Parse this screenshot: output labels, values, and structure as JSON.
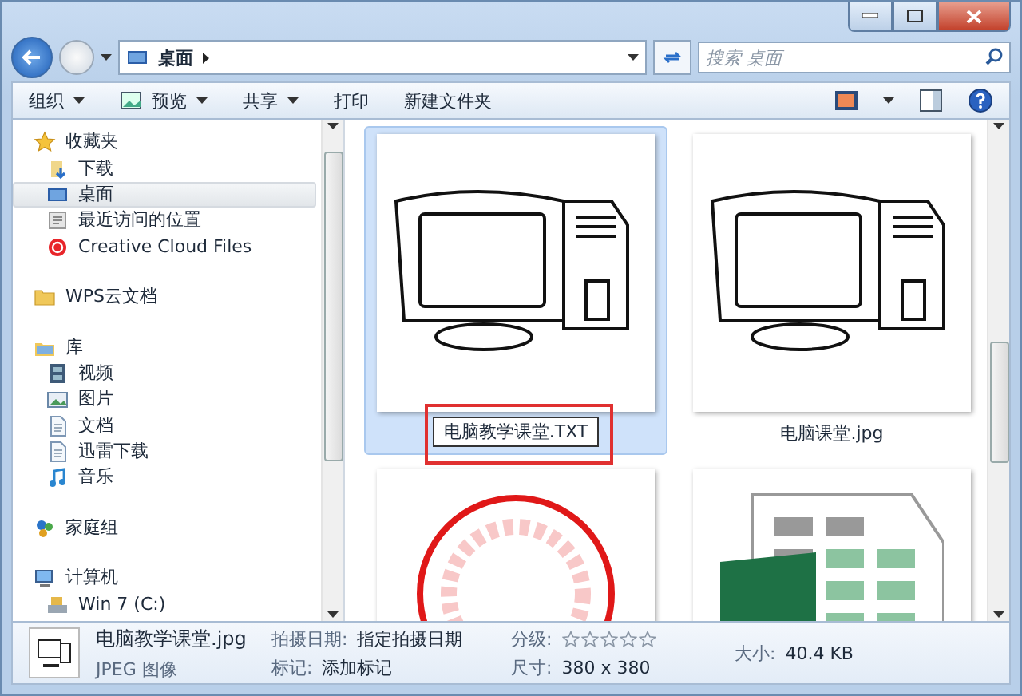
{
  "address": {
    "path": [
      "桌面"
    ]
  },
  "search": {
    "placeholder": "搜索 桌面"
  },
  "toolbar": [
    {
      "label": "组织",
      "dropdown": true,
      "kind": "plain"
    },
    {
      "label": "预览",
      "dropdown": true,
      "kind": "preview"
    },
    {
      "label": "共享",
      "dropdown": true,
      "kind": "plain"
    },
    {
      "label": "打印",
      "dropdown": false,
      "kind": "plain"
    },
    {
      "label": "新建文件夹",
      "dropdown": false,
      "kind": "plain"
    }
  ],
  "sidebar": [
    {
      "label": "收藏夹",
      "kind": "star",
      "selected": false,
      "children": [
        {
          "label": "下载",
          "kind": "download",
          "selected": false
        },
        {
          "label": "桌面",
          "kind": "desktop",
          "selected": true
        },
        {
          "label": "最近访问的位置",
          "kind": "recent",
          "selected": false
        },
        {
          "label": "Creative Cloud Files",
          "kind": "cloud",
          "selected": false
        }
      ]
    },
    {
      "label": "WPS云文档",
      "kind": "folder",
      "selected": false
    },
    {
      "label": "库",
      "kind": "library",
      "selected": false,
      "children": [
        {
          "label": "视频",
          "kind": "video",
          "selected": false
        },
        {
          "label": "图片",
          "kind": "picture",
          "selected": false
        },
        {
          "label": "文档",
          "kind": "document",
          "selected": false
        },
        {
          "label": "迅雷下载",
          "kind": "document",
          "selected": false
        },
        {
          "label": "音乐",
          "kind": "music",
          "selected": false
        }
      ]
    },
    {
      "label": "家庭组",
      "kind": "homegroup",
      "selected": false
    },
    {
      "label": "计算机",
      "kind": "computer",
      "selected": false,
      "children": [
        {
          "label": "Win 7 (C:)",
          "kind": "drive",
          "selected": false
        }
      ]
    }
  ],
  "files": [
    {
      "name": "电脑教学课堂.TXT",
      "kind": "computer-drawing",
      "selected": true,
      "renaming": true
    },
    {
      "name": "电脑课堂.jpg",
      "kind": "computer-drawing",
      "selected": false,
      "renaming": false
    },
    {
      "kind": "stamp",
      "selected": false
    },
    {
      "kind": "spreadsheet",
      "selected": false
    }
  ],
  "details": {
    "name": "电脑教学课堂.jpg",
    "type": "JPEG 图像",
    "columns": [
      [
        {
          "label": "拍摄日期:",
          "value": "指定拍摄日期"
        },
        {
          "label": "标记:",
          "value": "添加标记"
        }
      ],
      [
        {
          "label": "分级:",
          "kind": "rating",
          "stars": 0
        },
        {
          "label": "尺寸:",
          "value": "380 x 380"
        }
      ],
      [
        {
          "label": "大小:",
          "value": "40.4 KB"
        }
      ]
    ]
  }
}
